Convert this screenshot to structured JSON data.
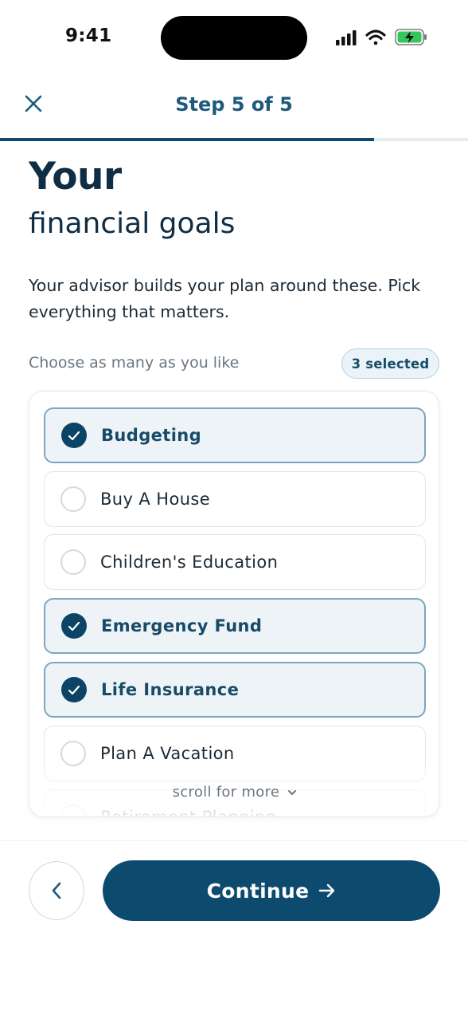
{
  "status_bar": {
    "time": "9:41",
    "icons": [
      "signal-icon",
      "wifi-icon",
      "battery-charging-icon"
    ],
    "battery_color": "#34c759"
  },
  "header": {
    "close_icon": "close-icon",
    "step_title": "Step 5 of 5",
    "progress_fraction": 0.8,
    "accent_color": "#0c4a6e"
  },
  "intro": {
    "title": "Your",
    "subtitle": "financial goals",
    "description": "Your advisor builds your plan around these. Pick everything that matters."
  },
  "selection": {
    "hint": "Choose as many as you like",
    "count_label": "3 selected"
  },
  "goals": [
    {
      "label": "Budgeting",
      "selected": true
    },
    {
      "label": "Buy A House",
      "selected": false
    },
    {
      "label": "Children's Education",
      "selected": false
    },
    {
      "label": "Emergency Fund",
      "selected": true
    },
    {
      "label": "Life Insurance",
      "selected": true
    },
    {
      "label": "Plan A Vacation",
      "selected": false
    },
    {
      "label": "Retirement Planning",
      "selected": false
    }
  ],
  "scroll_hint": "scroll for more",
  "footer": {
    "back_icon": "chevron-left-icon",
    "continue_label": "Continue",
    "continue_icon": "arrow-right-icon"
  }
}
